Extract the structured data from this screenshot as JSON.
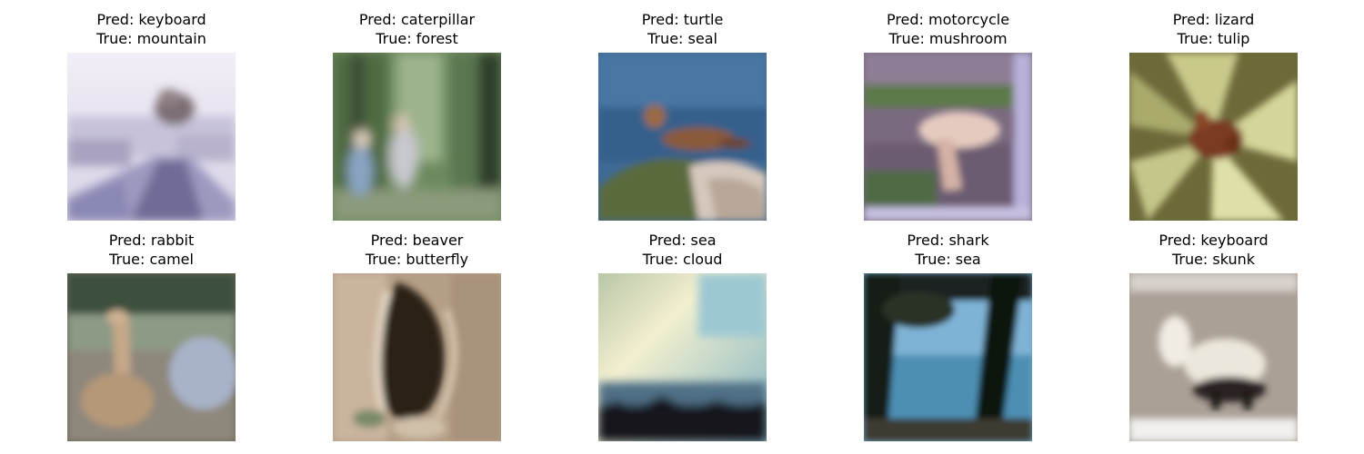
{
  "panels": [
    {
      "pred": "Pred: keyboard",
      "true": "True: mountain"
    },
    {
      "pred": "Pred: caterpillar",
      "true": "True: forest"
    },
    {
      "pred": "Pred: turtle",
      "true": "True: seal"
    },
    {
      "pred": "Pred: motorcycle",
      "true": "True: mushroom"
    },
    {
      "pred": "Pred: lizard",
      "true": "True: tulip"
    },
    {
      "pred": "Pred: rabbit",
      "true": "True: camel"
    },
    {
      "pred": "Pred: beaver",
      "true": "True: butterfly"
    },
    {
      "pred": "Pred: sea",
      "true": "True: cloud"
    },
    {
      "pred": "Pred: shark",
      "true": "True: sea"
    },
    {
      "pred": "Pred: keyboard",
      "true": "True: skunk"
    }
  ]
}
